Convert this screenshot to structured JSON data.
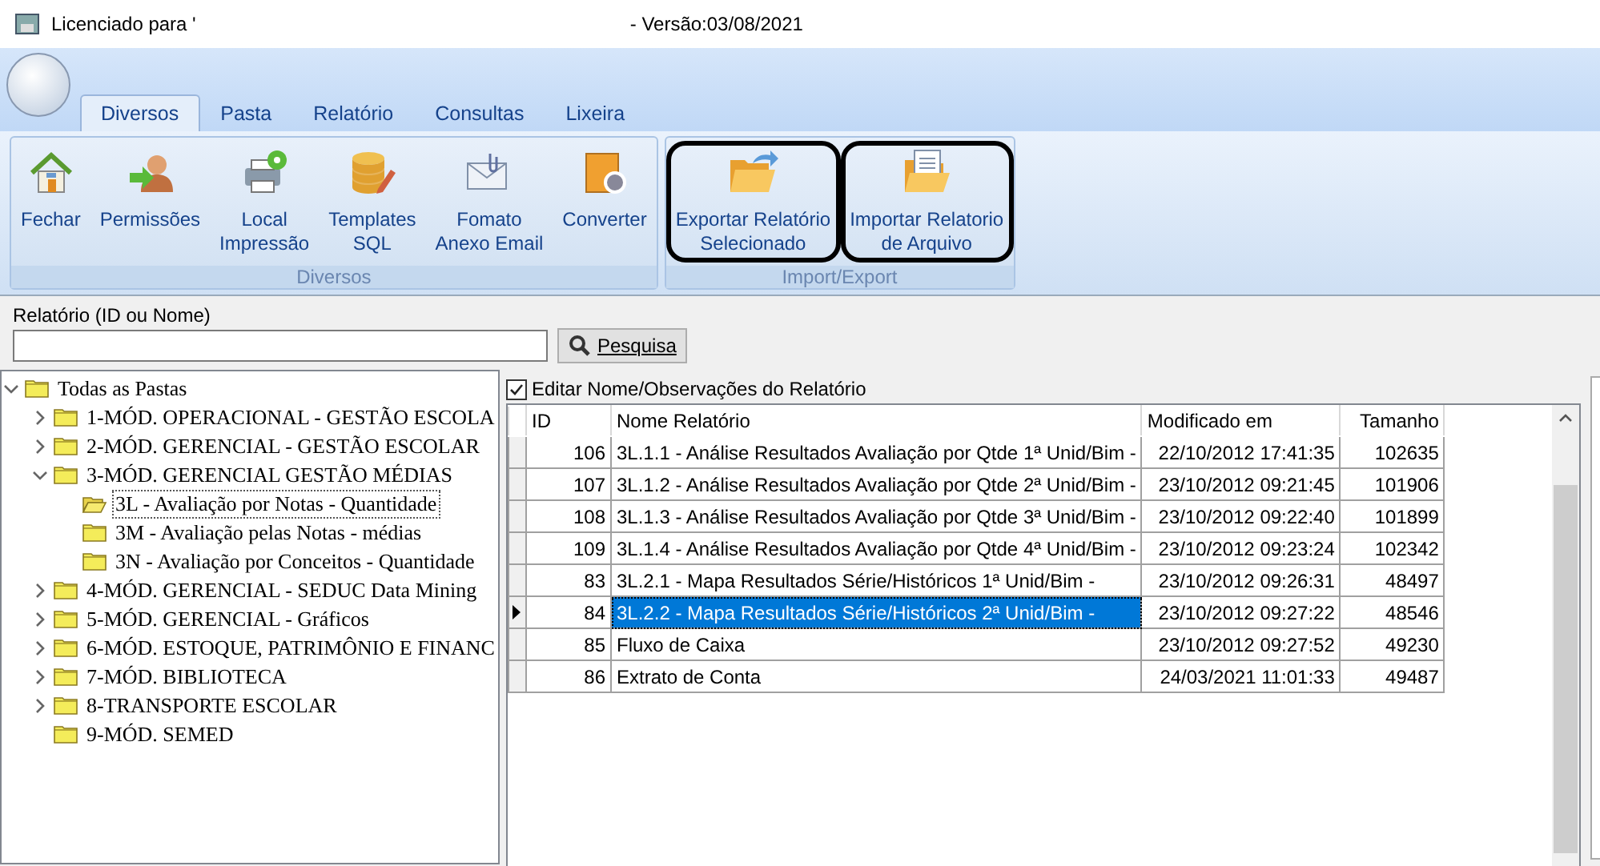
{
  "window": {
    "title": "Licenciado para '",
    "version": "- Versão:03/08/2021"
  },
  "ribbon": {
    "tabs": [
      {
        "label": "Diversos",
        "selected": true
      },
      {
        "label": "Pasta",
        "selected": false
      },
      {
        "label": "Relatório",
        "selected": false
      },
      {
        "label": "Consultas",
        "selected": false
      },
      {
        "label": "Lixeira",
        "selected": false
      }
    ],
    "groups": [
      {
        "label": "Diversos",
        "buttons": [
          {
            "label": "Fechar",
            "highlighted": false
          },
          {
            "label": "Permissões",
            "highlighted": false
          },
          {
            "label": "Local\nImpressão",
            "highlighted": false
          },
          {
            "label": "Templates\nSQL",
            "highlighted": false
          },
          {
            "label": "Fomato\nAnexo Email",
            "highlighted": false
          },
          {
            "label": "Converter",
            "highlighted": false
          }
        ]
      },
      {
        "label": "Import/Export",
        "buttons": [
          {
            "label": "Exportar Relatório\nSelecionado",
            "highlighted": true
          },
          {
            "label": "Importar Relatorio\nde Arquivo",
            "highlighted": true
          }
        ]
      }
    ]
  },
  "search": {
    "label": "Relatório (ID ou Nome)",
    "button": "Pesquisa"
  },
  "tree": [
    {
      "label": "Todas as Pastas",
      "expanded": true,
      "selected": false,
      "children": [
        {
          "label": "1-MÓD. OPERACIONAL - GESTÃO ESCOLA",
          "expanded": false,
          "selected": false
        },
        {
          "label": "2-MÓD. GERENCIAL - GESTÃO ESCOLAR",
          "expanded": false,
          "selected": false
        },
        {
          "label": "3-MÓD. GERENCIAL GESTÃO MÉDIAS",
          "expanded": true,
          "selected": false,
          "children": [
            {
              "label": "3L - Avaliação por Notas - Quantidade",
              "selected": true
            },
            {
              "label": "3M - Avaliação pelas Notas -  médias",
              "selected": false
            },
            {
              "label": "3N - Avaliação por Conceitos - Quantidade",
              "selected": false
            }
          ]
        },
        {
          "label": "4-MÓD. GERENCIAL - SEDUC Data Mining",
          "expanded": false,
          "selected": false
        },
        {
          "label": "5-MÓD. GERENCIAL - Gráficos",
          "expanded": false,
          "selected": false
        },
        {
          "label": "6-MÓD. ESTOQUE, PATRIMÔNIO E FINANC",
          "expanded": false,
          "selected": false
        },
        {
          "label": "7-MÓD. BIBLIOTECA",
          "expanded": false,
          "selected": false
        },
        {
          "label": "8-TRANSPORTE ESCOLAR",
          "expanded": false,
          "selected": false
        },
        {
          "label": "9-MÓD. SEMED",
          "selected": false
        }
      ]
    }
  ],
  "edit_checkbox": {
    "label": "Editar Nome/Observações do Relatório",
    "checked": true
  },
  "table": {
    "columns": [
      "ID",
      "Nome Relatório",
      "Modificado em",
      "Tamanho"
    ],
    "rows": [
      {
        "cells": [
          "106",
          "3L.1.1 - Análise Resultados Avaliação por Qtde 1ª Unid/Bim -",
          "22/10/2012 17:41:35",
          "102635"
        ],
        "selected": false
      },
      {
        "cells": [
          "107",
          "3L.1.2 - Análise Resultados Avaliação por Qtde 2ª Unid/Bim -",
          "23/10/2012 09:21:45",
          "101906"
        ],
        "selected": false
      },
      {
        "cells": [
          "108",
          "3L.1.3 - Análise Resultados Avaliação por Qtde 3ª Unid/Bim -",
          "23/10/2012 09:22:40",
          "101899"
        ],
        "selected": false
      },
      {
        "cells": [
          "109",
          "3L.1.4 - Análise Resultados Avaliação por Qtde 4ª Unid/Bim -",
          "23/10/2012 09:23:24",
          "102342"
        ],
        "selected": false
      },
      {
        "cells": [
          "83",
          "3L.2.1 - Mapa Resultados Série/Históricos 1ª Unid/Bim -",
          "23/10/2012 09:26:31",
          "48497"
        ],
        "selected": false
      },
      {
        "cells": [
          "84",
          "3L.2.2 - Mapa Resultados Série/Históricos 2ª Unid/Bim -",
          "23/10/2012 09:27:22",
          "48546"
        ],
        "selected": true
      },
      {
        "cells": [
          "85",
          "Fluxo de Caixa",
          "23/10/2012 09:27:52",
          "49230"
        ],
        "selected": false
      },
      {
        "cells": [
          "86",
          "Extrato de Conta",
          "24/03/2021 11:01:33",
          "49487"
        ],
        "selected": false
      }
    ]
  }
}
